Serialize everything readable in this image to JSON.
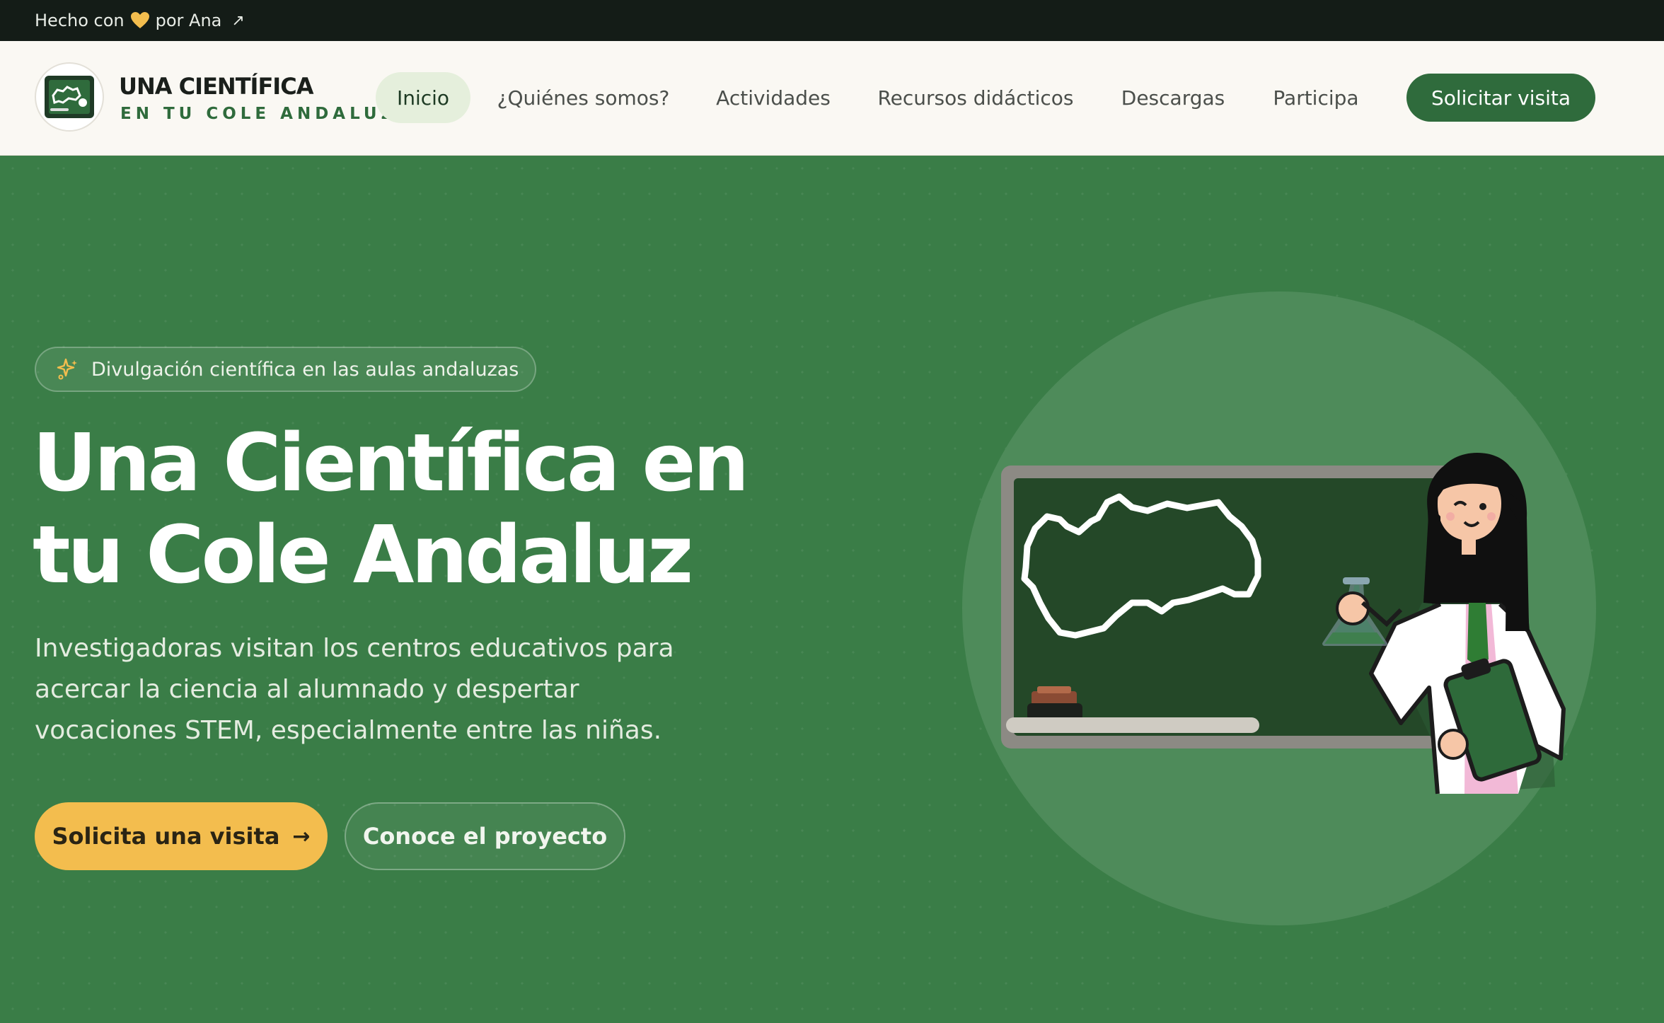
{
  "top_strip": {
    "made_with": "Hecho con",
    "by": "por Ana",
    "link_icon": "arrow-up-right-icon",
    "heart_color": "#f3bd4e"
  },
  "header": {
    "brand_line1": "UNA CIENTÍFICA",
    "brand_line2": "EN TU COLE ANDALUZ",
    "nav": [
      "Inicio",
      "¿Quiénes somos?",
      "Actividades",
      "Recursos didácticos",
      "Descargas",
      "Participa"
    ],
    "active_nav": "Inicio",
    "cta": "Solicitar visita"
  },
  "hero": {
    "badge": "Divulgación científica en las aulas andaluzas",
    "title_line1": "Una Científica en",
    "title_line2": "tu Cole Andaluz",
    "description": "Investigadoras visitan los centros educativos para acercar la ciencia al alumnado y despertar vocaciones STEM, especialmente entre las niñas.",
    "primary_button": "Solicita una visita",
    "secondary_button": "Conoce el proyecto"
  },
  "colors": {
    "brand_green": "#2f6b3c",
    "hero_bg": "#3a7d47",
    "accent_yellow": "#f3bd4e",
    "dark_strip": "#141c17"
  }
}
